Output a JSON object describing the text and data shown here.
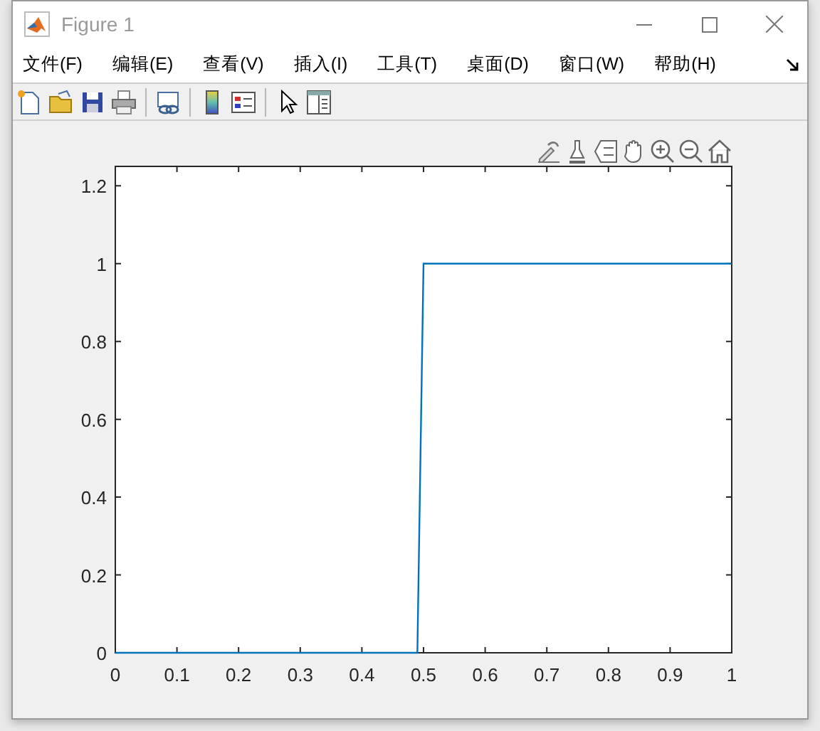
{
  "window": {
    "title": "Figure 1"
  },
  "menu": [
    "文件(F)",
    "编辑(E)",
    "查看(V)",
    "插入(I)",
    "工具(T)",
    "桌面(D)",
    "窗口(W)",
    "帮助(H)"
  ],
  "plot": {
    "chart_data": {
      "type": "line",
      "x": [
        0,
        0.49,
        0.5,
        1
      ],
      "series": [
        {
          "color": "#0072bd",
          "values": [
            0,
            0,
            1,
            1
          ]
        }
      ],
      "xlim": [
        0,
        1
      ],
      "ylim": [
        0,
        1.25
      ],
      "xticks": [
        0,
        0.1,
        0.2,
        0.3,
        0.4,
        0.5,
        0.6,
        0.7,
        0.8,
        0.9,
        1
      ],
      "yticks": [
        0,
        0.2,
        0.4,
        0.6,
        0.8,
        1,
        1.2
      ]
    }
  }
}
